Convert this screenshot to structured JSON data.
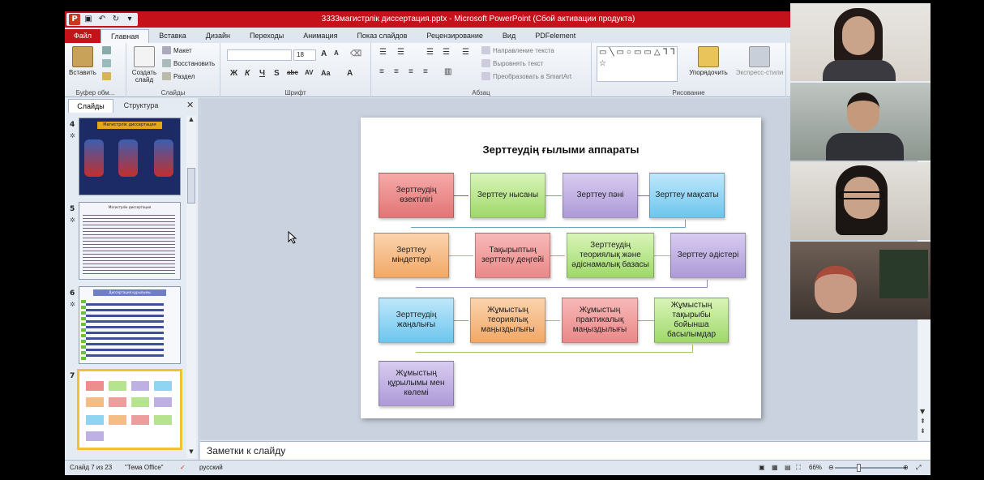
{
  "titlebar": {
    "title": "3333магистрлік диссертация.pptx  -  Microsoft PowerPoint (Сбой активации продукта)",
    "qat_icons": [
      "powerpoint-icon",
      "save-icon",
      "undo-icon",
      "redo-icon",
      "customize-icon"
    ]
  },
  "tabs": [
    "Файл",
    "Главная",
    "Вставка",
    "Дизайн",
    "Переходы",
    "Анимация",
    "Показ слайдов",
    "Рецензирование",
    "Вид",
    "PDFelement"
  ],
  "ribbon": {
    "clipboard": {
      "paste": "Вставить",
      "label": "Буфер обм..."
    },
    "slides": {
      "new_slide": "Создать слайд",
      "layout": "Макет",
      "reset": "Восстановить",
      "section": "Раздел",
      "label": "Слайды"
    },
    "font": {
      "size": "18",
      "buttons": [
        "Ж",
        "К",
        "Ч",
        "S",
        "abc",
        "AV",
        "Aa",
        "A"
      ],
      "label": "Шрифт"
    },
    "paragraph": {
      "text_direction": "Направление текста",
      "align_text": "Выровнять текст",
      "smartart": "Преобразовать в SmartArt",
      "label": "Абзац"
    },
    "drawing": {
      "arrange": "Упорядочить",
      "quick_styles": "Экспресс-стили",
      "label": "Рисование"
    }
  },
  "panel": {
    "tabs": [
      "Слайды",
      "Структура"
    ],
    "slide_numbers": [
      "4",
      "5",
      "6",
      "7"
    ],
    "thumb4_title": "Магистрлік диссертация",
    "thumb5_title": "Магистрлік диссертация",
    "thumb6_title": "Диссертация құрылымы"
  },
  "slide": {
    "title": "Зерттеудің ғылыми аппараты",
    "boxes": [
      "Зерттеудің өзектілігі",
      "Зерттеу нысаны",
      "Зерттеу пәні",
      "Зерттеу мақсаты",
      "Зерттеу міндеттері",
      "Тақырыптың зерттелу деңгейі",
      "Зерттеудің теориялық және әдіснамалық базасы",
      "Зерттеу әдістері",
      "Зерттеудің жаңалығы",
      "Жұмыстың теориялық маңыздылығы",
      "Жұмыстың практикалық маңыздылығы",
      "Жұмыстың тақырыбы бойынша басылымдар",
      "Жұмыстың құрылымы мен көлемі"
    ]
  },
  "notes": {
    "placeholder": "Заметки к слайду"
  },
  "status": {
    "slide_of": "Слайд 7 из 23",
    "theme": "\"Тема Office\"",
    "language": "русский",
    "zoom": "66%"
  },
  "colors": {
    "title_bar": "#c4111a",
    "selected_thumb": "#f1c232"
  }
}
